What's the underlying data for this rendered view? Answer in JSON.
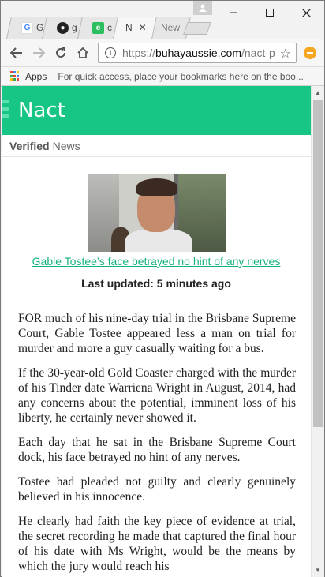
{
  "browser": {
    "tabs": [
      {
        "label": "G",
        "favicon": "google-icon",
        "favicon_color": "#ffffff"
      },
      {
        "label": "g",
        "favicon": "github-icon",
        "favicon_color": "#222222"
      },
      {
        "label": "c",
        "favicon": "evernote-icon",
        "favicon_color": "#2dbe60"
      },
      {
        "label": "N",
        "favicon": "page-icon",
        "favicon_color": "#17c585",
        "active": true
      },
      {
        "label": "New",
        "favicon": "none"
      }
    ],
    "url": {
      "scheme": "https://",
      "host": "buhayaussie.com",
      "path": "/nact-p"
    },
    "bookmarks": {
      "apps_label": "Apps",
      "hint": "For quick access, place your bookmarks here on the boo..."
    }
  },
  "site": {
    "title": "Nact",
    "subtitle_bold": "Verified",
    "subtitle_rest": "News",
    "brand_color": "#17c585"
  },
  "article": {
    "image_caption": "Gable Tostee’s face betrayed no hint of any nerves",
    "updated": "Last updated: 5 minutes ago",
    "paragraphs": [
      "FOR much of his nine-day trial in the Brisbane Supreme Court, Gable Tostee appeared less a man on trial for murder and more a guy casually waiting for a bus.",
      "If the 30-year-old Gold Coaster charged with the murder of his Tinder date Warriena Wright in August, 2014, had any concerns about the potential, imminent loss of his liberty, he certainly never showed it.",
      "Each day that he sat in the Brisbane Supreme Court dock, his face betrayed no hint of any nerves.",
      "Tostee had pleaded not guilty and clearly genuinely believed in his innocence.",
      "He clearly had faith the key piece of evidence at trial, the secret recording he made that captured the final hour of his date with Ms Wright, would be the means by which the jury would reach his"
    ]
  }
}
